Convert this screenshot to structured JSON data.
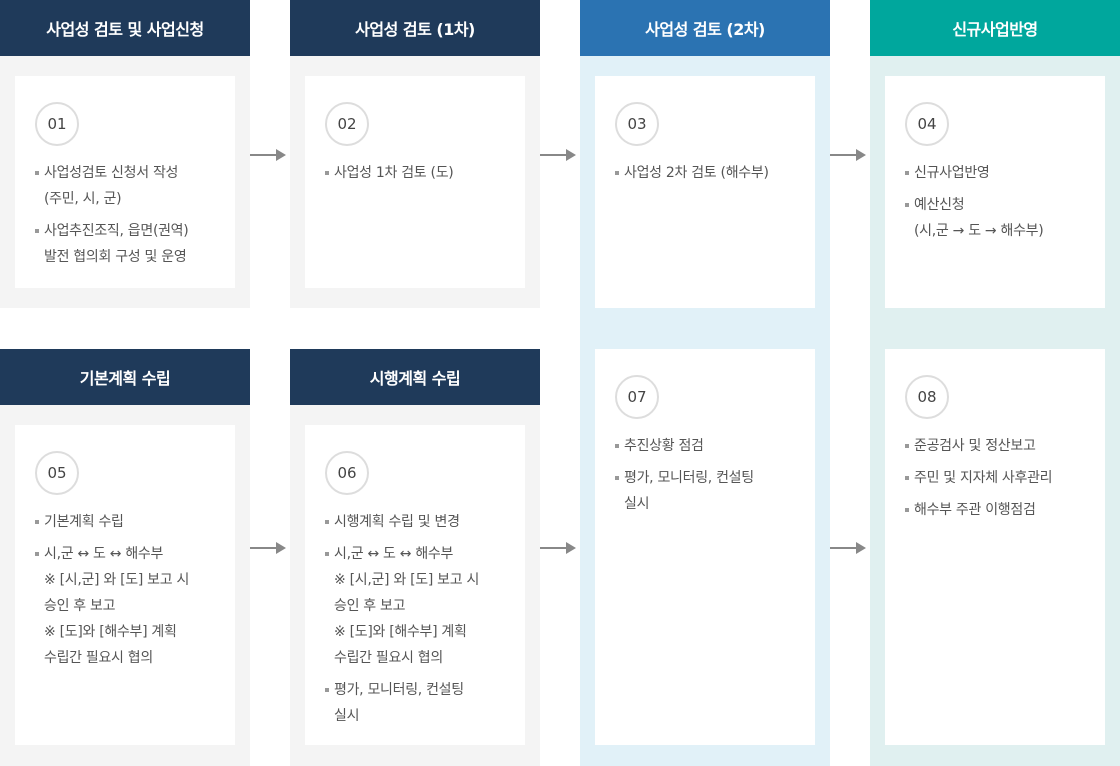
{
  "colors": {
    "dark_header": "#1f3a5a",
    "blue_header": "#2b73b2",
    "teal_header": "#00a79d",
    "gray_panel": "#f4f4f4",
    "lightblue_panel": "#e1f1f8",
    "teal_panel": "#e0f0f0",
    "arrow": "#888888"
  },
  "headers": {
    "h1": "사업성 검토 및 사업신청",
    "h2": "사업성 검토 (1차)",
    "h3": "사업성 검토 (2차)",
    "h4": "신규사업반영",
    "h5": "기본계획 수립",
    "h6": "시행계획 수립"
  },
  "steps": [
    {
      "num": "01",
      "items": [
        [
          "사업성검토 신청서 작성",
          "(주민, 시, 군)"
        ],
        [
          "사업추진조직, 읍면(권역)",
          "발전 협의회 구성 및 운영"
        ]
      ]
    },
    {
      "num": "02",
      "items": [
        [
          "사업성 1차 검토 (도)"
        ]
      ]
    },
    {
      "num": "03",
      "items": [
        [
          "사업성 2차 검토 (해수부)"
        ]
      ]
    },
    {
      "num": "04",
      "items": [
        [
          "신규사업반영"
        ],
        [
          "예산신청",
          "(시,군 → 도 → 해수부)"
        ]
      ]
    },
    {
      "num": "05",
      "items": [
        [
          "기본계획 수립"
        ],
        [
          "시,군  ↔ 도 ↔ 해수부",
          "※ [시,군] 와 [도] 보고 시",
          "승인 후 보고",
          "※ [도]와 [해수부] 계획",
          "수립간 필요시 협의"
        ]
      ]
    },
    {
      "num": "06",
      "items": [
        [
          "시행계획 수립 및 변경"
        ],
        [
          "시,군  ↔ 도 ↔ 해수부",
          "※ [시,군] 와 [도] 보고 시",
          "승인 후 보고",
          "※ [도]와 [해수부] 계획",
          "수립간 필요시 협의"
        ],
        [
          "평가, 모니터링, 컨설팅",
          "실시"
        ]
      ]
    },
    {
      "num": "07",
      "items": [
        [
          "추진상황 점검"
        ],
        [
          "평가, 모니터링, 컨설팅",
          "실시"
        ]
      ]
    },
    {
      "num": "08",
      "items": [
        [
          "준공검사 및 정산보고"
        ],
        [
          "주민 및 지자체 사후관리"
        ],
        [
          "해수부 주관 이행점검"
        ]
      ]
    }
  ]
}
